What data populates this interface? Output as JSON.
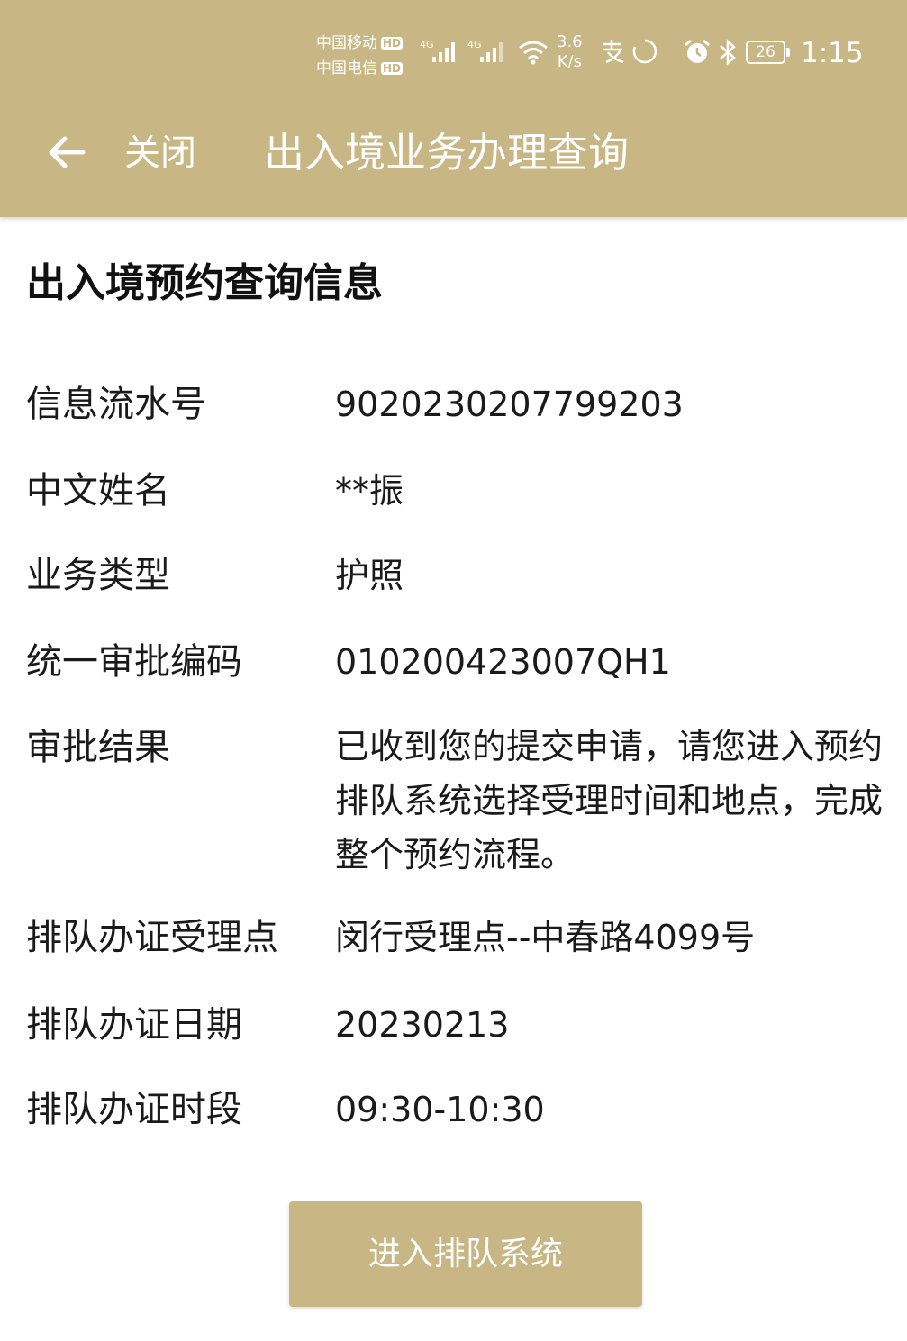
{
  "status_bar": {
    "carrier1": "中国移动",
    "carrier2": "中国电信",
    "hd_badge": "HD",
    "net_speed_value": "3.6",
    "net_speed_unit": "K/s",
    "battery": "26",
    "time": "1:15",
    "icons": [
      "signal-4g-icon",
      "signal-4g-icon",
      "wifi-icon",
      "alipay-icon",
      "loading-icon",
      "alarm-icon",
      "bluetooth-icon",
      "battery-icon"
    ]
  },
  "nav": {
    "back_icon": "arrow-left-icon",
    "close_label": "关闭",
    "title": "出入境业务办理查询"
  },
  "section": {
    "title": "出入境预约查询信息"
  },
  "fields": [
    {
      "label": "信息流水号",
      "value": "9020230207799203"
    },
    {
      "label": "中文姓名",
      "value": "**振"
    },
    {
      "label": "业务类型",
      "value": "护照"
    },
    {
      "label": "统一审批编码",
      "value": "010200423007QH1"
    },
    {
      "label": "审批结果",
      "value": "已收到您的提交申请，请您进入预约排队系统选择受理时间和地点，完成整个预约流程。"
    },
    {
      "label": "排队办证受理点",
      "value": "闵行受理点--中春路4099号"
    },
    {
      "label": "排队办证日期",
      "value": "20230213"
    },
    {
      "label": "排队办证时段",
      "value": "09:30-10:30"
    }
  ],
  "button": {
    "label": "进入排队系统"
  },
  "colors": {
    "brand": "#c8b684",
    "text": "#1a1a1a",
    "background": "#ffffff"
  }
}
